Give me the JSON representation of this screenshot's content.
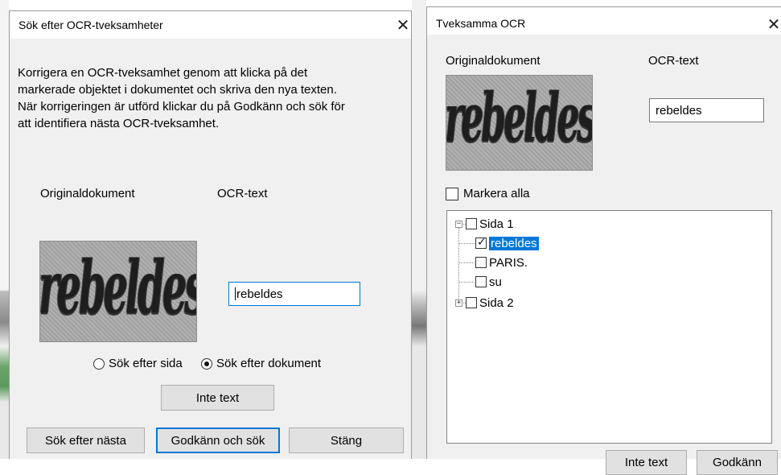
{
  "left_dialog": {
    "title": "Sök efter OCR-tveksamheter",
    "close_icon": "close-icon",
    "instructions": [
      "Korrigera en OCR-tveksamhet genom att klicka på det",
      "markerade objektet i dokumentet och skriva den nya texten.",
      "När korrigeringen är utförd klickar du på Godkänn och sök för",
      "att identifiera nästa OCR-tveksamhet."
    ],
    "original_label": "Originaldokument",
    "ocr_label": "OCR-text",
    "image_word": "rebeldes",
    "ocr_value": "rebeldes",
    "radio_page": "Sök efter sida",
    "radio_document": "Sök efter dokument",
    "radio_selected": "document",
    "btn_not_text": "Inte text",
    "btn_search_next": "Sök efter nästa",
    "btn_approve_search": "Godkänn och sök",
    "btn_close": "Stäng"
  },
  "right_dialog": {
    "title": "Tveksamma OCR",
    "close_icon": "close-icon",
    "original_label": "Originaldokument",
    "ocr_label": "OCR-text",
    "image_word": "rebeldes",
    "ocr_value": "rebeldes",
    "select_all_label": "Markera alla",
    "tree": {
      "page1_label": "Sida 1",
      "items": [
        {
          "label": "rebeldes",
          "checked": true,
          "selected": true
        },
        {
          "label": "PARIS.",
          "checked": false,
          "selected": false
        },
        {
          "label": "su",
          "checked": false,
          "selected": false
        }
      ],
      "page2_label": "Sida 2"
    },
    "btn_not_text": "Inte text",
    "btn_approve": "Godkänn"
  },
  "colors": {
    "dialog_bg": "#f0f0f0",
    "accent": "#0078d7",
    "button_bg": "#e1e1e1"
  }
}
